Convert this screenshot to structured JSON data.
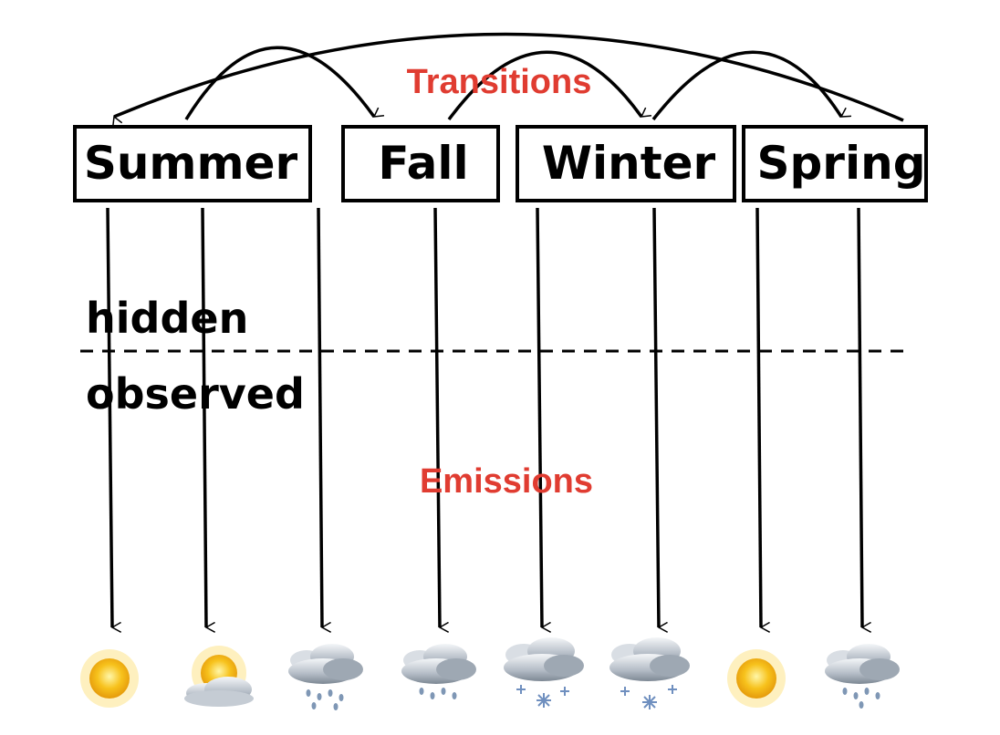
{
  "states": [
    {
      "label": "Summer"
    },
    {
      "label": "Fall"
    },
    {
      "label": "Winter"
    },
    {
      "label": "Spring"
    }
  ],
  "labels": {
    "transitions": "Transitions",
    "emissions": "Emissions",
    "hidden": "hidden",
    "observed": "observed"
  },
  "observations": [
    {
      "icon": "sunny-icon"
    },
    {
      "icon": "partly-sunny-icon"
    },
    {
      "icon": "rain-icon"
    },
    {
      "icon": "rain-icon"
    },
    {
      "icon": "snow-icon"
    },
    {
      "icon": "snow-icon"
    },
    {
      "icon": "sunny-icon"
    },
    {
      "icon": "rain-icon"
    }
  ],
  "colors": {
    "accent_red": "#e03c31",
    "sun": "#f7c21c",
    "cloud": "#b9c2cc"
  }
}
